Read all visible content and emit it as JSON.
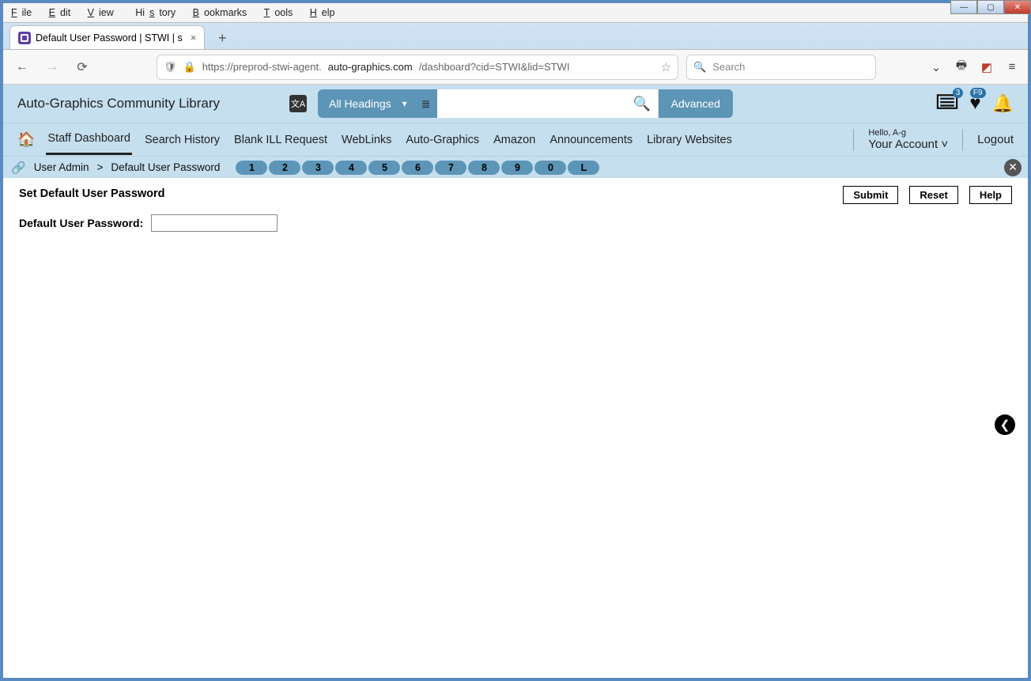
{
  "browser": {
    "menu": [
      {
        "u": "F",
        "rest": "ile"
      },
      {
        "u": "E",
        "rest": "dit"
      },
      {
        "u": "V",
        "rest": "iew"
      },
      {
        "u": "",
        "rest": "Hi",
        "u2": "s",
        "rest2": "tory"
      },
      {
        "u": "B",
        "rest": "ookmarks"
      },
      {
        "u": "T",
        "rest": "ools"
      },
      {
        "u": "H",
        "rest": "elp"
      }
    ],
    "tab_title": "Default User Password | STWI | s",
    "url_prefix": "https://preprod-stwi-agent.",
    "url_host_dark": "auto-graphics.com",
    "url_path": "/dashboard?cid=STWI&lid=STWI",
    "search_placeholder": "Search"
  },
  "site": {
    "title": "Auto-Graphics Community Library",
    "search_scope": "All Headings",
    "advanced_label": "Advanced",
    "badges": {
      "list": "3",
      "heart": "F9"
    }
  },
  "nav": {
    "items": [
      "Staff Dashboard",
      "Search History",
      "Blank ILL Request",
      "WebLinks",
      "Auto-Graphics",
      "Amazon",
      "Announcements",
      "Library Websites"
    ],
    "active_index": 0,
    "hello": "Hello, A-g",
    "your_account": "Your Account",
    "logout": "Logout"
  },
  "breadcrumb": {
    "text_a": "User Admin",
    "sep": ">",
    "text_b": "Default User Password",
    "pills": [
      "1",
      "2",
      "3",
      "4",
      "5",
      "6",
      "7",
      "8",
      "9",
      "0",
      "L"
    ]
  },
  "page": {
    "heading": "Set Default User Password",
    "field_label": "Default User Password:",
    "field_value": "",
    "submit": "Submit",
    "reset": "Reset",
    "help": "Help"
  }
}
